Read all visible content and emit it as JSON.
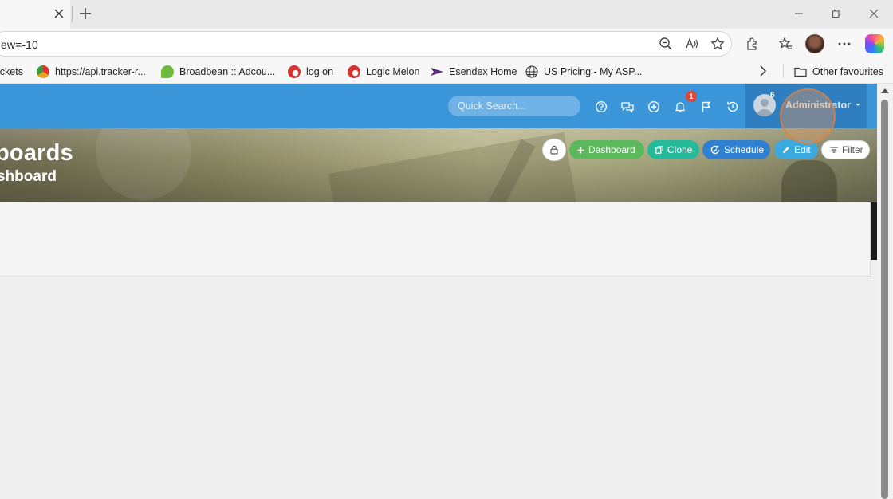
{
  "browser": {
    "address": "ew=-10",
    "favourites": [
      {
        "label": "ickets"
      },
      {
        "label": "https://api.tracker-r..."
      },
      {
        "label": "Broadbean :: Adcou..."
      },
      {
        "label": "log on"
      },
      {
        "label": "Logic Melon"
      },
      {
        "label": "Esendex Home"
      },
      {
        "label": "US Pricing - My ASP..."
      }
    ],
    "other_favourites": "Other favourites"
  },
  "header": {
    "search_placeholder": "Quick Search...",
    "notification_count": "1",
    "user_badge": "6",
    "user_name": "Administrator"
  },
  "hero": {
    "title": "boards",
    "subtitle": "shboard"
  },
  "actions": {
    "dashboard": "Dashboard",
    "clone": "Clone",
    "schedule": "Schedule",
    "edit": "Edit",
    "filter": "Filter"
  },
  "colors": {
    "header": "#3a96d8",
    "dashboard_btn": "#5cb85c",
    "clone_btn": "#26b99a",
    "schedule_btn": "#2f80d1",
    "edit_btn": "#3aaae0",
    "notification_badge": "#e0453a"
  }
}
